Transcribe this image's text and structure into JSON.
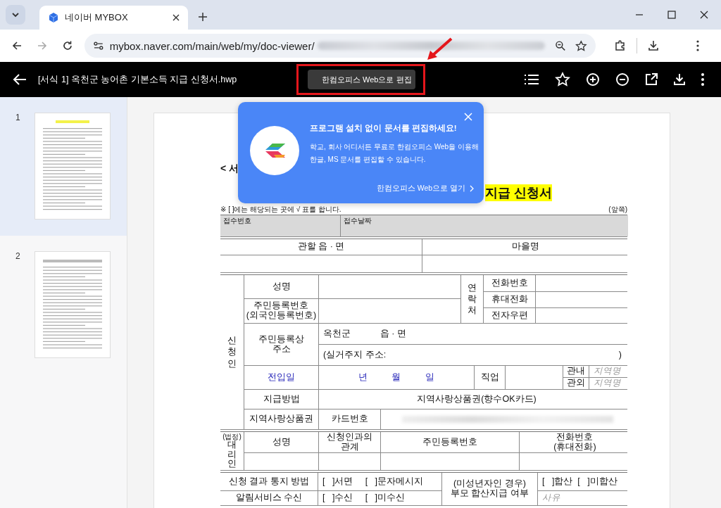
{
  "browser": {
    "tabs": [
      {
        "title": "네이버 MYBOX",
        "selected": true
      }
    ],
    "url": "mybox.naver.com/main/web/my/doc-viewer/"
  },
  "viewer": {
    "title": "[서식 1] 옥천군 농어촌 기본소득 지급 신청서.hwp",
    "edit_button": "한컴오피스 Web으로 편집"
  },
  "pages": [
    {
      "number": "1",
      "selected": true
    },
    {
      "number": "2",
      "selected": false
    }
  ],
  "popup": {
    "title": "프로그램 설치 없이 문서를 편집하세요!",
    "body": "학교, 회사 어디서든 무료로 한컴오피스 Web을 이용해\n한글, MS 문서를 편집할 수 있습니다.",
    "link": "한컴오피스 Web으로 열기"
  },
  "document": {
    "heading": "< 서",
    "title": "지급 신청서",
    "note": "※ [   ]에는 해당되는 곳에 √ 표를 합니다.",
    "side_note": "(앞쪽)",
    "blocks": [
      {
        "cells": [
          {
            "text": "접수번호",
            "kind": "shaded"
          },
          {
            "text": "접수날짜",
            "kind": "shaded"
          }
        ]
      },
      {
        "cells": [
          {
            "text": "관할 읍 · 면",
            "kind": "label"
          },
          {
            "text": "마을명",
            "kind": "label"
          }
        ]
      },
      {
        "cells": [
          {
            "text": "신청인",
            "kind": "vertical"
          },
          {
            "text": "성명",
            "kind": "label"
          },
          {
            "text": "연락처",
            "kind": "vertical"
          },
          {
            "text": "전화번호",
            "kind": "label"
          },
          {
            "text": "휴대전화",
            "kind": "label"
          },
          {
            "text": "전자우편",
            "kind": "label"
          },
          {
            "text": "주민등록번호\n(외국인등록번호)",
            "kind": "label"
          },
          {
            "text": "주민등록상\n주소",
            "kind": "label"
          },
          {
            "text": "옥천군            읍 · 면",
            "kind": "value"
          },
          {
            "text": "(실거주지 주소:",
            "end": ")",
            "kind": "value"
          },
          {
            "text": "전입일",
            "kind": "accent"
          },
          {
            "text": "년          월          일",
            "kind": "accent"
          },
          {
            "text": "직업",
            "kind": "label"
          },
          {
            "text": "관내",
            "kind": "label"
          },
          {
            "text": "지역명",
            "kind": "hint"
          },
          {
            "text": "관외",
            "kind": "label"
          },
          {
            "text": "지역명",
            "kind": "hint"
          },
          {
            "text": "지급방법",
            "kind": "label"
          },
          {
            "text": "지역사랑상품권(향수OK카드)",
            "kind": "label"
          },
          {
            "text": "지역사랑상품권",
            "kind": "label"
          },
          {
            "text": "카드번호",
            "kind": "label"
          },
          {
            "kind": "redacted"
          }
        ]
      },
      {
        "cells": [
          {
            "prefix": "(법정)",
            "text": "대리인",
            "kind": "vertical"
          },
          {
            "text": "성명",
            "kind": "label"
          },
          {
            "text": "신청인과의\n관계",
            "kind": "label"
          },
          {
            "text": "주민등록번호",
            "kind": "label"
          },
          {
            "text": "전화번호\n(휴대전화)",
            "kind": "label"
          }
        ]
      },
      {
        "cells": [
          {
            "text": "신청 결과 통지 방법",
            "kind": "label"
          },
          {
            "text": "[   ]서면     [   ]문자메시지",
            "kind": "value"
          },
          {
            "text": "(미성년자인 경우)\n부모 합산지급 여부",
            "kind": "label"
          },
          {
            "text": "[   ]합산  [   ]미합산",
            "kind": "value"
          },
          {
            "text": "알림서비스 수신",
            "kind": "label"
          },
          {
            "text": "[   ]수신     [   ]미수신",
            "kind": "value"
          },
          {
            "text": "사유",
            "kind": "hint"
          }
        ]
      }
    ]
  }
}
